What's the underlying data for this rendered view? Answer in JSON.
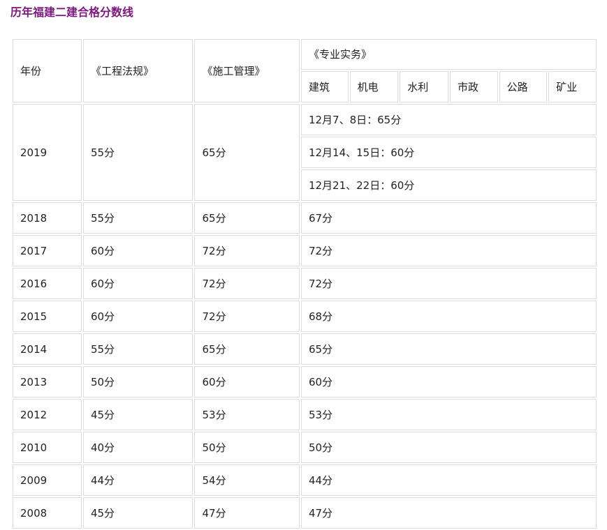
{
  "title": "历年福建二建合格分数线",
  "table": {
    "header": {
      "year": "年份",
      "law": "《工程法规》",
      "management": "《施工管理》",
      "practice": "《专业实务》",
      "practice_subjects": [
        "建筑",
        "机电",
        "水利",
        "市政",
        "公路",
        "矿业"
      ]
    },
    "row_2019": {
      "year": "2019",
      "law": "55分",
      "management": "65分",
      "practice": [
        "12月7、8日：65分",
        "12月14、15日：60分",
        "12月21、22日：60分"
      ]
    },
    "rows": [
      {
        "year": "2018",
        "law": "55分",
        "management": "65分",
        "practice": "67分"
      },
      {
        "year": "2017",
        "law": "60分",
        "management": "72分",
        "practice": "72分"
      },
      {
        "year": "2016",
        "law": "60分",
        "management": "72分",
        "practice": "72分"
      },
      {
        "year": "2015",
        "law": "60分",
        "management": "72分",
        "practice": "68分"
      },
      {
        "year": "2014",
        "law": "55分",
        "management": "65分",
        "practice": "65分"
      },
      {
        "year": "2013",
        "law": "50分",
        "management": "60分",
        "practice": "60分"
      },
      {
        "year": "2012",
        "law": "45分",
        "management": "53分",
        "practice": "53分"
      },
      {
        "year": "2010",
        "law": "40分",
        "management": "50分",
        "practice": "50分"
      },
      {
        "year": "2009",
        "law": "44分",
        "management": "54分",
        "practice": "44分"
      },
      {
        "year": "2008",
        "law": "45分",
        "management": "47分",
        "practice": "47分"
      }
    ]
  },
  "colors": {
    "title": "#7a1a7a",
    "border": "#dcdcdc",
    "text": "#222222"
  }
}
